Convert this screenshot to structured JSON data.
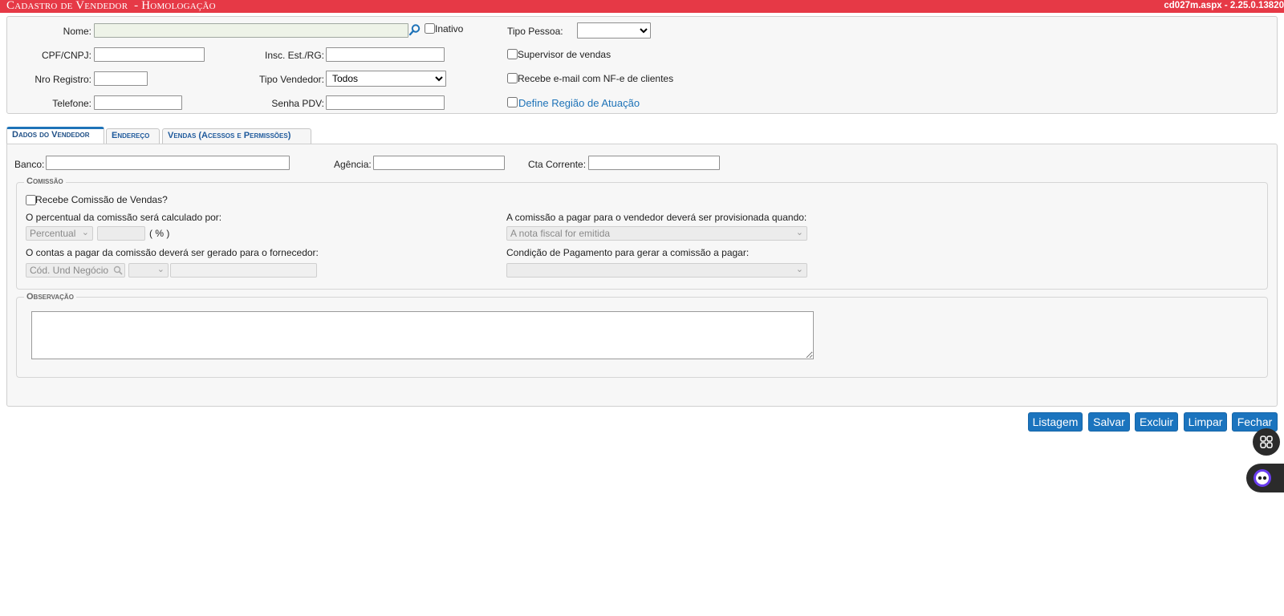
{
  "header": {
    "title": "Cadastro de Vendedor  - Homologação",
    "version": "cd027m.aspx - 2.25.0.13820"
  },
  "form": {
    "nome_label": "Nome:",
    "inativo_label": "Inativo",
    "tipo_pessoa_label": "Tipo Pessoa:",
    "tipo_pessoa_value": "",
    "cpf_label": "CPF/CNPJ:",
    "insc_label": "Insc. Est./RG:",
    "supervisor_label": "Supervisor de vendas",
    "nro_registro_label": "Nro Registro:",
    "tipo_vendedor_label": "Tipo Vendedor:",
    "tipo_vendedor_value": "Todos",
    "recebe_email_label": "Recebe e-mail com NF-e de clientes",
    "telefone_label": "Telefone:",
    "senha_pdv_label": "Senha PDV:",
    "define_regiao_label": "Define Região de Atuação"
  },
  "tabs": [
    {
      "label": "Dados do Vendedor",
      "active": true
    },
    {
      "label": "Endereço",
      "active": false
    },
    {
      "label": "Vendas (Acessos e Permissões)",
      "active": false
    }
  ],
  "dados": {
    "banco_label": "Banco:",
    "agencia_label": "Agência:",
    "cta_label": "Cta Corrente:"
  },
  "comissao": {
    "legend": "Comissão",
    "recebe_label": "Recebe Comissão de Vendas?",
    "percentual_label": "O percentual da comissão será calculado por:",
    "percentual_select": "Percentual",
    "percent_unit": "( % )",
    "provisionada_label": "A comissão a pagar para o vendedor deverá ser provisionada quando:",
    "provisionada_value": "A nota fiscal for emitida",
    "contas_label": "O contas a pagar da comissão deverá ser gerado para o fornecedor:",
    "cod_und_placeholder": "Cód. Und Negócio",
    "condicao_label": "Condição de Pagamento para gerar a comissão a pagar:",
    "condicao_value": ""
  },
  "observacao": {
    "legend": "Observação"
  },
  "buttons": {
    "listagem": "Listagem",
    "salvar": "Salvar",
    "excluir": "Excluir",
    "limpar": "Limpar",
    "fechar": "Fechar"
  },
  "colors": {
    "titlebar": "#e63946",
    "button": "#1b74be",
    "tab_text": "#1f5a9c"
  }
}
